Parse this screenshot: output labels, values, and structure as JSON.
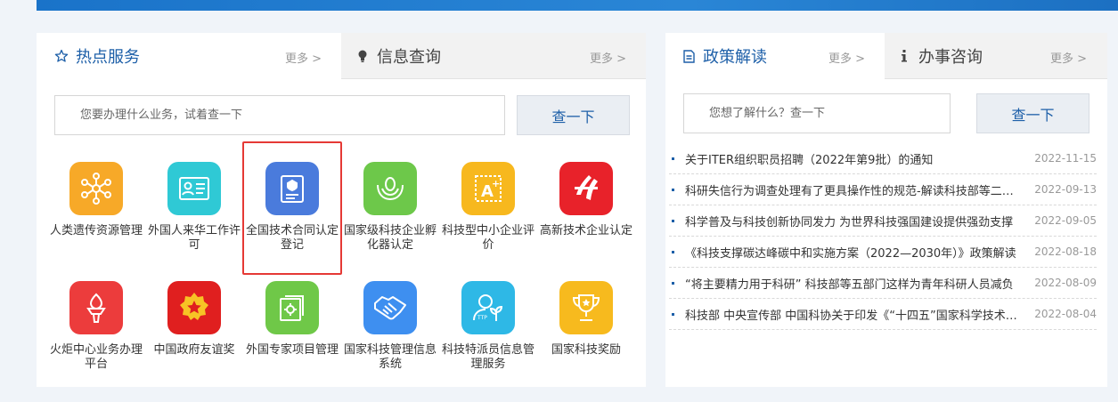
{
  "left_tabs": {
    "hot_services": {
      "label": "热点服务",
      "more": "更多 >"
    },
    "info_query": {
      "label": "信息查询",
      "more": "更多 >"
    }
  },
  "left_search": {
    "placeholder": "您要办理什么业务，试着查一下",
    "button": "查一下"
  },
  "services": [
    {
      "label": "人类遗传资源管理",
      "color": "#f7a928",
      "icon": "molecule-icon"
    },
    {
      "label": "外国人来华工作许可",
      "color": "#2fc9d5",
      "icon": "id-card-icon"
    },
    {
      "label": "全国技术合同认定登记",
      "color": "#4a7bdc",
      "icon": "contract-icon"
    },
    {
      "label": "国家级科技企业孵化器认定",
      "color": "#6dc84a",
      "icon": "sprout-icon"
    },
    {
      "label": "科技型中小企业评价",
      "color": "#f7b81e",
      "icon": "a-plus-icon"
    },
    {
      "label": "高新技术企业认定",
      "color": "#e8222a",
      "icon": "high-tech-icon"
    },
    {
      "label": "火炬中心业务办理平台",
      "color": "#ec3c3c",
      "icon": "torch-icon"
    },
    {
      "label": "中国政府友谊奖",
      "color": "#e01f1f",
      "icon": "medal-icon"
    },
    {
      "label": "外国专家项目管理",
      "color": "#6fc848",
      "icon": "folder-gear-icon"
    },
    {
      "label": "国家科技管理信息系统",
      "color": "#3e8ff0",
      "icon": "handshake-icon"
    },
    {
      "label": "科技特派员信息管理服务",
      "color": "#2eb8e6",
      "icon": "user-plant-icon"
    },
    {
      "label": "国家科技奖励",
      "color": "#f7ba1e",
      "icon": "trophy-icon"
    }
  ],
  "right_tabs": {
    "policy": {
      "label": "政策解读",
      "more": "更多 >"
    },
    "consult": {
      "label": "办事咨询",
      "more": "更多 >"
    }
  },
  "right_search": {
    "placeholder": "您想了解什么？查一下",
    "button": "查一下"
  },
  "news": [
    {
      "title": "关于ITER组织职员招聘（2022年第9批）的通知",
      "date": "2022-11-15"
    },
    {
      "title": "科研失信行为调查处理有了更具操作性的规范-解读科技部等二十二部门印发的《科研失信行为调查处理规则》",
      "date": "2022-09-13"
    },
    {
      "title": "科学普及与科技创新协同发力 为世界科技强国建设提供强劲支撑",
      "date": "2022-09-05"
    },
    {
      "title": "《科技支撑碳达峰碳中和实施方案（2022—2030年）》政策解读",
      "date": "2022-08-18"
    },
    {
      "title": "“将主要精力用于科研” 科技部等五部门这样为青年科研人员减负",
      "date": "2022-08-09"
    },
    {
      "title": "科技部 中央宣传部 中国科协关于印发《“十四五”国家科学技术普及发展规划》的通知",
      "date": "2022-08-04"
    }
  ]
}
